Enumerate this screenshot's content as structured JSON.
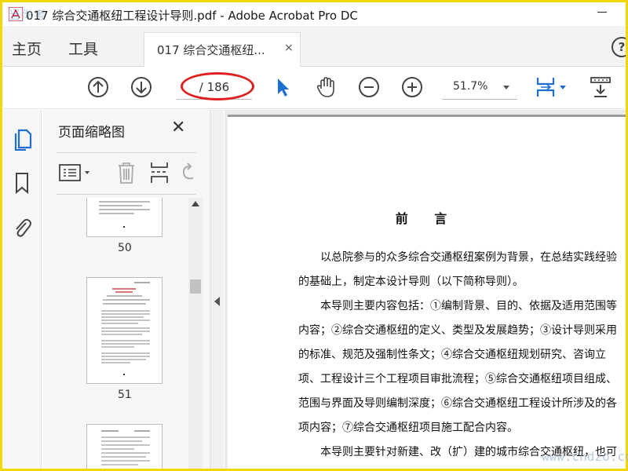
{
  "window": {
    "title": "017 综合交通枢纽工程设计导则.pdf - Adobe Acrobat Pro DC",
    "watermark_top": "当你考"
  },
  "tabs": {
    "home": "主页",
    "tools": "工具",
    "document": "017 综合交通枢纽...",
    "close": "×"
  },
  "toolbar": {
    "page_total": "/ 186",
    "zoom": "51.7%",
    "icons": [
      "up-arrow-icon",
      "down-arrow-icon",
      "select-arrow-icon",
      "hand-icon",
      "zoom-out-icon",
      "zoom-in-icon",
      "fit-page-icon",
      "scroll-mode-icon"
    ]
  },
  "panel": {
    "title": "页面缩略图",
    "close": "✕",
    "thumbnails": [
      {
        "label": "50"
      },
      {
        "label": "51"
      },
      {
        "label": ""
      }
    ]
  },
  "document": {
    "heading": "前 言",
    "paragraphs": [
      "以总院参与的众多综合交通枢纽案例为背景，在总结实践经验的基础上，制定本设计导则（以下简称导则）。",
      "本导则主要内容包括：①编制背景、目的、依据及适用范围等内容；②综合交通枢纽的定义、类型及发展趋势；③设计导则采用的标准、规范及强制性条文；④综合交通枢纽规划研究、咨询立项、工程设计三个工程项目审批流程；⑤综合交通枢纽项目组成、范围与界面及导则编制深度；⑥综合交通枢纽工程设计所涉及的各项内容；⑦综合交通枢纽项目施工配合内容。",
      "本导则主要针对新建、改（扩）建的城市综合交通枢纽，也可用"
    ]
  },
  "watermark_bottom": "www.cndzo.com",
  "colors": {
    "frame": "#f0d800",
    "accent_blue": "#1f6fd1",
    "annotation_red": "#e02020"
  }
}
